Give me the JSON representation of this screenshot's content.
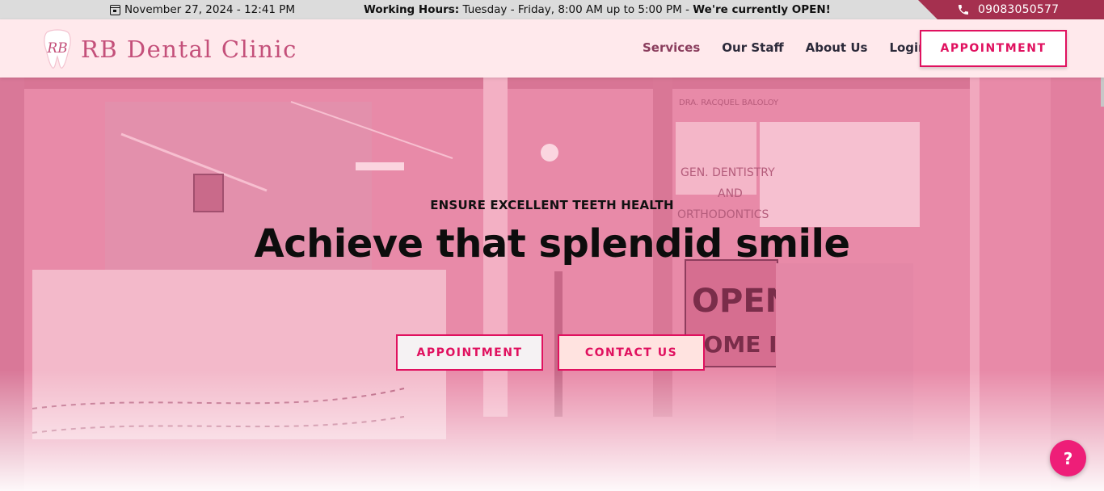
{
  "topbar": {
    "date": "November 27, 2024 - 12:41 PM",
    "hours_label": "Working Hours:",
    "hours_text": " Tuesday - Friday, 8:00 AM up to 5:00 PM - ",
    "status_text": "We're currently OPEN!",
    "phone": "09083050577"
  },
  "brand": {
    "name": "RB Dental Clinic",
    "logo_letters": "RB"
  },
  "nav": {
    "items": [
      "Services",
      "Our Staff",
      "About Us",
      "Login"
    ],
    "cta": "APPOINTMENT"
  },
  "hero": {
    "eyebrow": "ENSURE EXCELLENT TEETH HEALTH",
    "headline": "Achieve that splendid smile",
    "primary_button": "APPOINTMENT",
    "secondary_button": "CONTACT US",
    "sign_text_1": "DRA. RACQUEL BALOLOY",
    "sign_text_2": "GEN. DENTISTRY",
    "sign_text_3": "AND",
    "sign_text_4": "ORTHODONTICS",
    "sign_text_5": "OPEN",
    "sign_text_6": "COME IN"
  },
  "help": {
    "label": "?"
  },
  "colors": {
    "accent": "#e0115f",
    "brand": "#c4507a",
    "phone_bar": "#a5304f",
    "nav_bg": "#ffe9ec"
  }
}
